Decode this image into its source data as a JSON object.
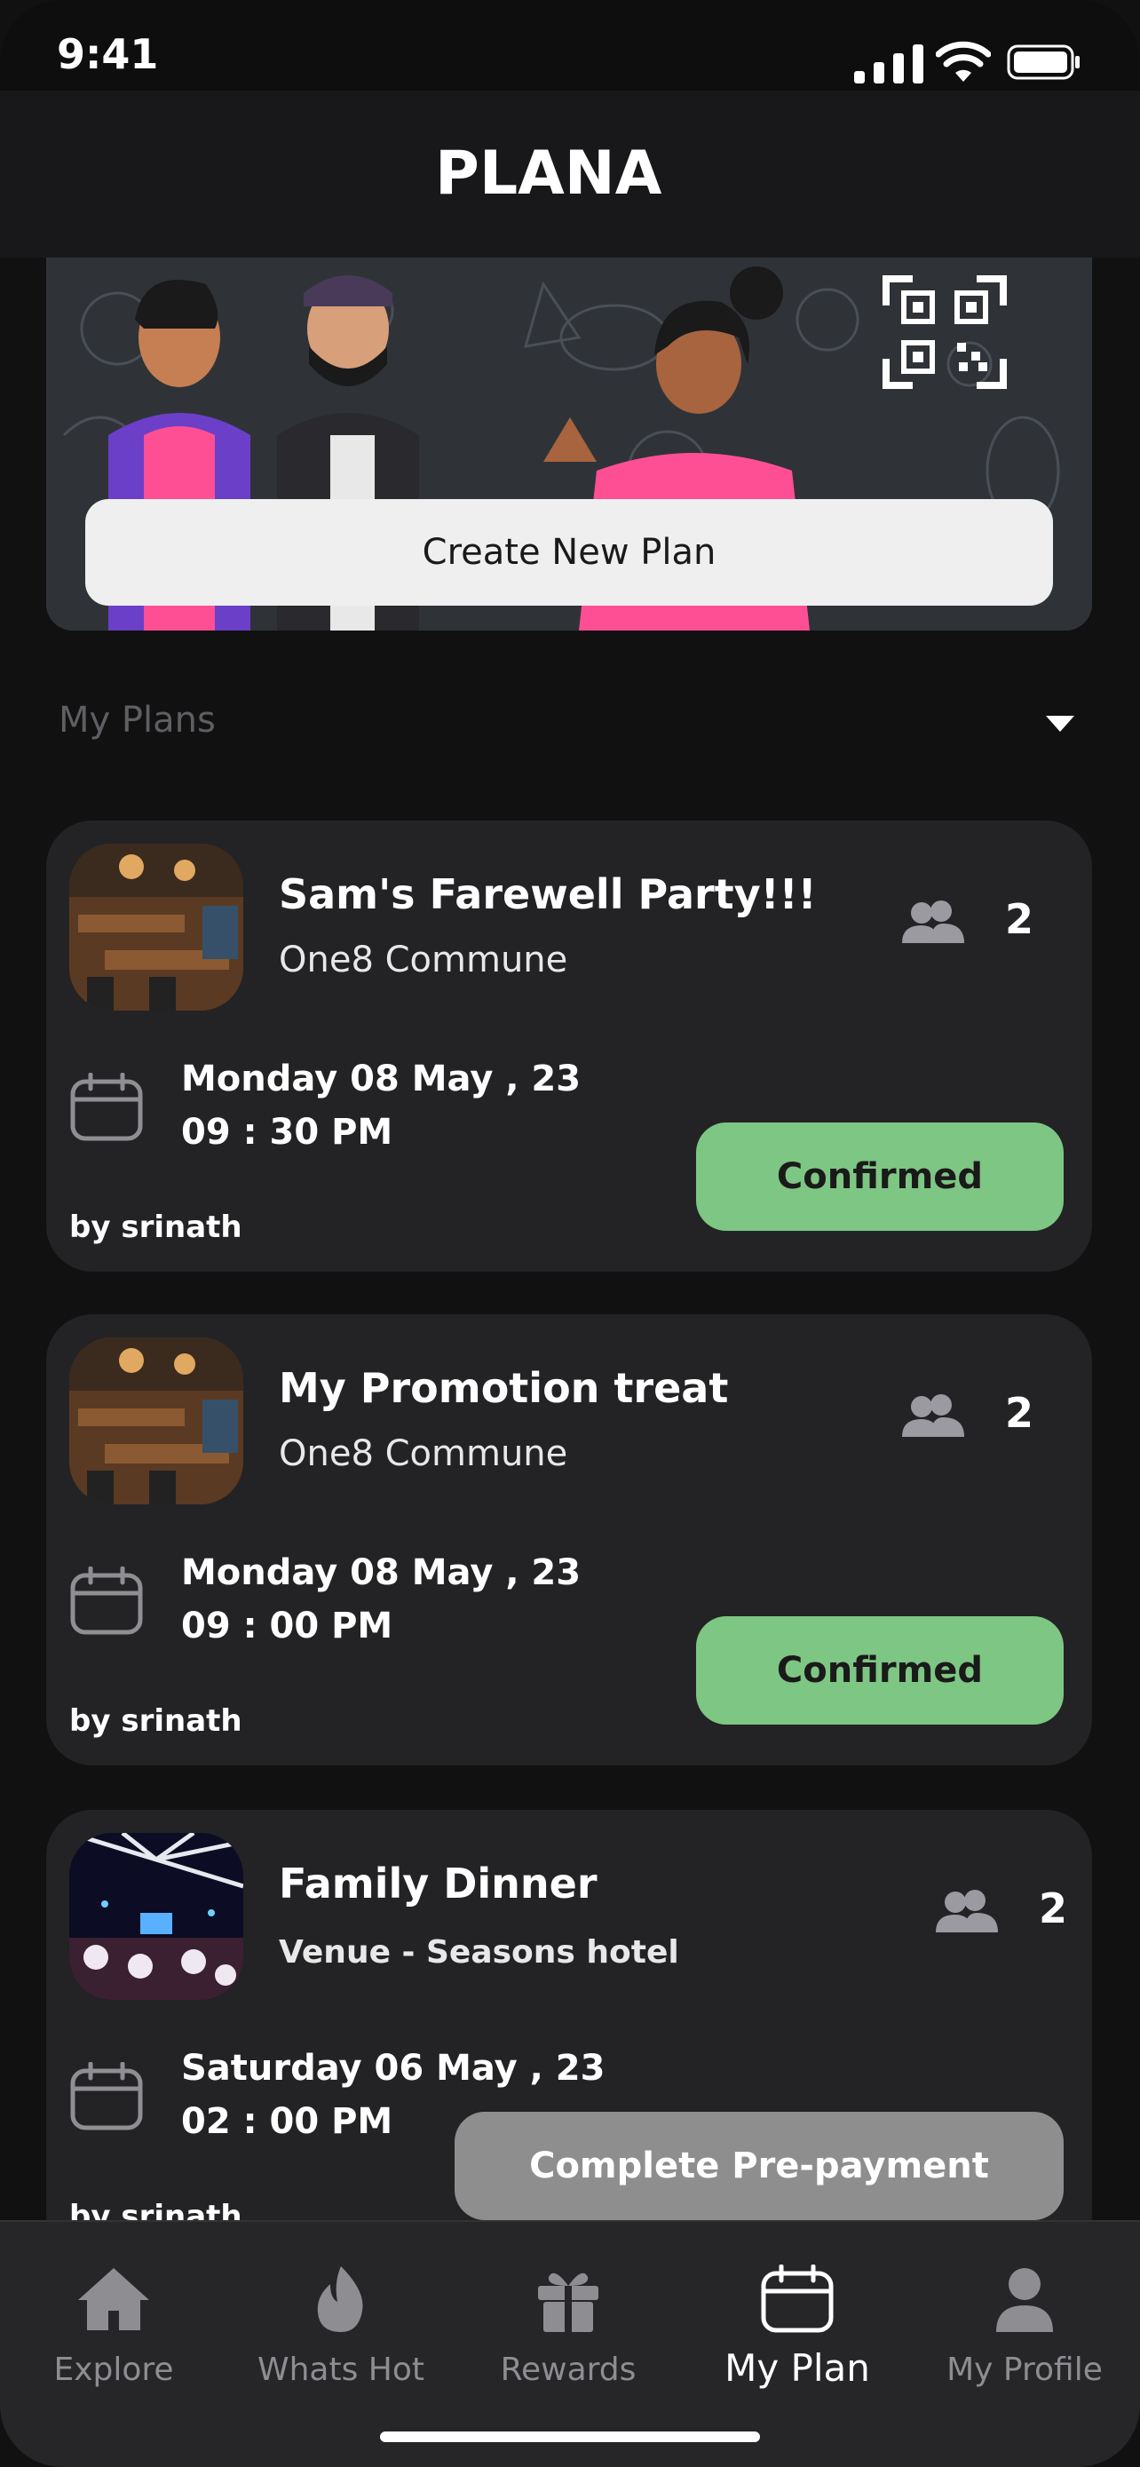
{
  "status_bar": {
    "time": "9:41"
  },
  "header": {
    "logo_text": "PLANA"
  },
  "banner": {
    "create_button_label": "Create New Plan"
  },
  "plans_section": {
    "title": "My Plans"
  },
  "plans": [
    {
      "title": "Sam's Farewell Party!!!",
      "venue": "One8 Commune",
      "guests": "2",
      "date": "Monday 08 May , 23",
      "time": "09 : 30  PM",
      "organizer": "by srinath",
      "status": "Confirmed"
    },
    {
      "title": "My Promotion treat",
      "venue": "One8 Commune",
      "guests": "2",
      "date": "Monday 08 May , 23",
      "time": "09 : 00  PM",
      "organizer": "by srinath",
      "status": "Confirmed"
    },
    {
      "title": "Family Dinner",
      "venue": "Venue - Seasons hotel",
      "guests": "2",
      "date": "Saturday 06 May , 23",
      "time": "02 : 00  PM",
      "organizer": "by srinath",
      "status": "Complete Pre-payment"
    }
  ],
  "tabs": [
    {
      "label": "Explore",
      "icon": "home-icon"
    },
    {
      "label": "Whats Hot",
      "icon": "flame-icon"
    },
    {
      "label": "Rewards",
      "icon": "gift-icon"
    },
    {
      "label": "My Plan",
      "icon": "calendar-icon",
      "active": true
    },
    {
      "label": "My Profile",
      "icon": "user-icon"
    }
  ],
  "colors": {
    "confirmed": "#7ec683",
    "pending": "#8e8e8e",
    "card": "#232325",
    "background": "#111112"
  }
}
